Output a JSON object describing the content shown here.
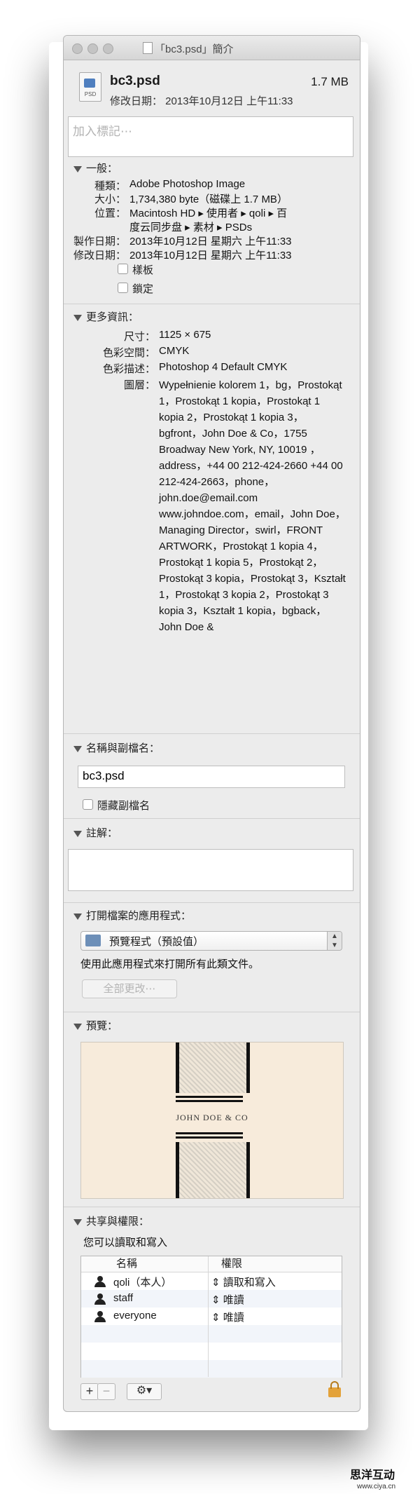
{
  "window": {
    "title": "「bc3.psd」簡介"
  },
  "file": {
    "icon_label": "PSD",
    "name": "bc3.psd",
    "size": "1.7 MB",
    "modified": "修改日期： 2013年10月12日 上午11:33"
  },
  "tags": {
    "placeholder": "加入標記⋯"
  },
  "general": {
    "header": "一般：",
    "rows": [
      {
        "label": "種類：",
        "value": "Adobe Photoshop Image"
      },
      {
        "label": "大小：",
        "value": "1,734,380 byte（磁碟上 1.7 MB）"
      },
      {
        "label": "位置：",
        "value": "Macintosh HD ▸ 使用者 ▸ qoli ▸ 百"
      },
      {
        "label": "",
        "value": "度云同步盘 ▸ 素材 ▸ PSDs"
      },
      {
        "label": "製作日期：",
        "value": "2013年10月12日 星期六 上午11:33"
      },
      {
        "label": "修改日期：",
        "value": "2013年10月12日 星期六 上午11:33"
      }
    ],
    "stationery_label": "樣板",
    "locked_label": "鎖定"
  },
  "more_info": {
    "header": "更多資訊：",
    "dimensions_label": "尺寸：",
    "dimensions": "1125 × 675",
    "color_space_label": "色彩空間：",
    "color_space": "CMYK",
    "color_profile_label": "色彩描述：",
    "color_profile": "Photoshop 4 Default CMYK",
    "layers_label": "圖層：",
    "layers": "Wypełnienie kolorem 1，bg，Prostokąt 1，Prostokąt 1 kopia，Prostokąt 1 kopia 2，Prostokąt 1 kopia 3，bgfront，John Doe & Co，1755 Broadway New York, NY, 10019 ，address，+44 00 212-424-2660 +44 00 212-424-2663，phone，john.doe@email.com www.johndoe.com，email，John Doe，Managing Director，swirl，FRONT ARTWORK，Prostokąt 1 kopia 4，Prostokąt 1 kopia 5，Prostokąt 2，Prostokąt 3 kopia，Prostokąt 3，Kształt 1，Prostokąt 3 kopia 2，Prostokąt 3 kopia 3，Kształt 1 kopia，bgback，John Doe &"
  },
  "name_ext": {
    "header": "名稱與副檔名：",
    "filename": "bc3.psd",
    "hide_ext_label": "隱藏副檔名"
  },
  "comments": {
    "header": "註解："
  },
  "open_with": {
    "header": "打開檔案的應用程式：",
    "app": "預覽程式（預設值）",
    "description": "使用此應用程式來打開所有此類文件。",
    "change_all": "全部更改⋯"
  },
  "preview": {
    "header": "預覽：",
    "image_text": "JOHN DOE & CO"
  },
  "sharing": {
    "header": "共享與權限：",
    "status": "您可以讀取和寫入",
    "col_name": "名稱",
    "col_priv": "權限",
    "rows": [
      {
        "name": "qoli（本人）",
        "priv": "讀取和寫入"
      },
      {
        "name": "staff",
        "priv": "唯讀"
      },
      {
        "name": "everyone",
        "priv": "唯讀"
      }
    ],
    "add_button": "+",
    "remove_button": "−",
    "action_button": "⚙▾"
  },
  "watermark": {
    "cn": "思洋互动",
    "url": "www.ciya.cn"
  }
}
